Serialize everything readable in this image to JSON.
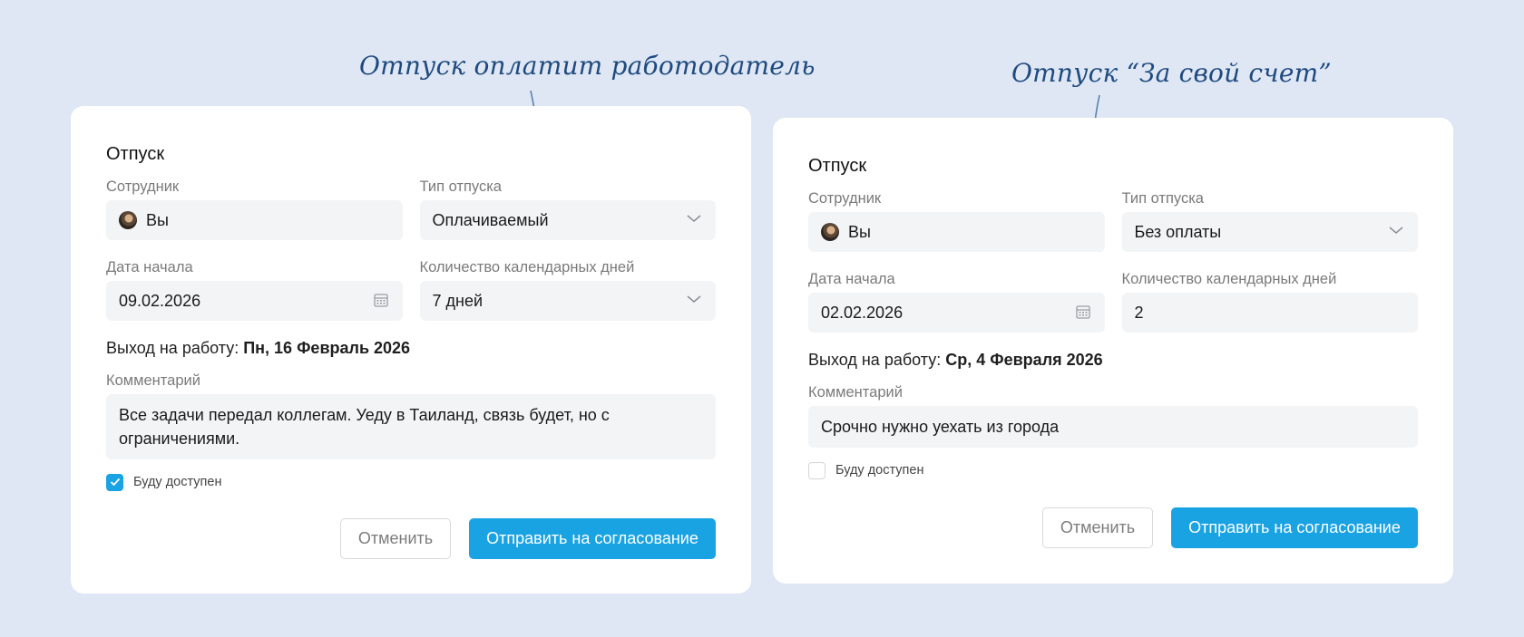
{
  "annotations": {
    "left": "Отпуск оплатит работодатель",
    "right": "Отпуск “За свой счет”"
  },
  "colors": {
    "background": "#dfe7f4",
    "accent": "#1aa3e3",
    "annotation": "#1e4a80"
  },
  "forms": [
    {
      "title": "Отпуск",
      "employee_label": "Сотрудник",
      "employee_value": "Вы",
      "type_label": "Тип отпуска",
      "type_value": "Оплачиваемый",
      "start_label": "Дата начала",
      "start_value": "09.02.2026",
      "days_label": "Количество календарных дней",
      "days_value": "7 дней",
      "return_prefix": "Выход на работу:",
      "return_date": "Пн, 16 Февраль 2026",
      "comment_label": "Комментарий",
      "comment_value": "Все задачи передал коллегам. Уеду в Таиланд, связь будет, но с ограничениями.",
      "available_label": "Буду доступен",
      "available_checked": true,
      "cancel_label": "Отменить",
      "submit_label": "Отправить на согласование"
    },
    {
      "title": "Отпуск",
      "employee_label": "Сотрудник",
      "employee_value": "Вы",
      "type_label": "Тип отпуска",
      "type_value": "Без оплаты",
      "start_label": "Дата начала",
      "start_value": "02.02.2026",
      "days_label": "Количество календарных дней",
      "days_value": "2",
      "return_prefix": "Выход на работу:",
      "return_date": "Ср, 4 Февраля 2026",
      "comment_label": "Комментарий",
      "comment_value": "Срочно нужно уехать из города",
      "available_label": "Буду доступен",
      "available_checked": false,
      "cancel_label": "Отменить",
      "submit_label": "Отправить на согласование"
    }
  ]
}
